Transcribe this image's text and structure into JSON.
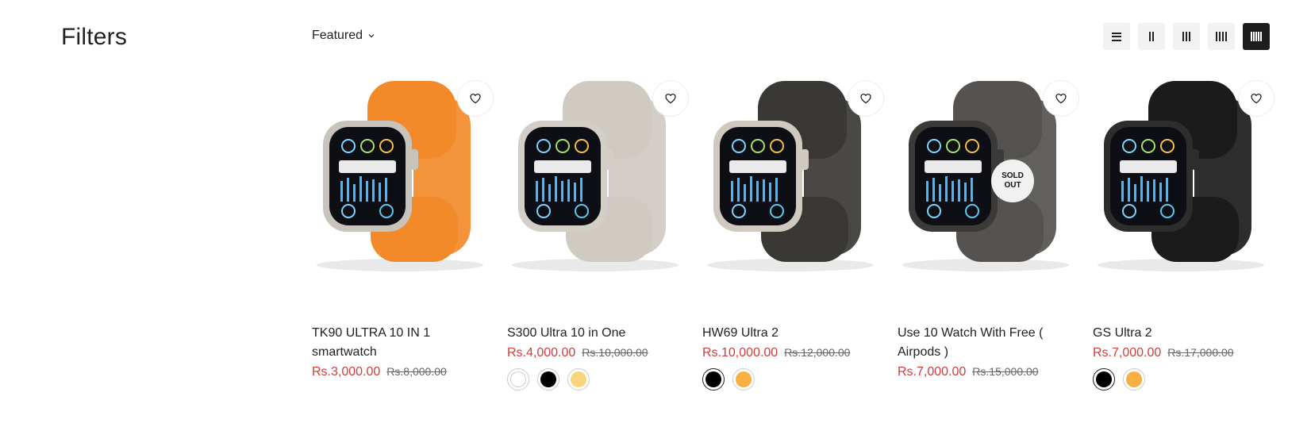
{
  "sidebar": {
    "title": "Filters"
  },
  "toolbar": {
    "sort_label": "Featured"
  },
  "layout_options": [
    "list",
    "2-columns",
    "3-columns",
    "4-columns",
    "5-columns"
  ],
  "active_layout": "5-columns",
  "products": [
    {
      "title": "TK90 ULTRA 10 IN 1 smartwatch",
      "sale_price": "Rs.3,000.00",
      "compare_price": "Rs.8,000.00",
      "band_color": "#f28a2a",
      "case_color": "#c9c4bb",
      "swatches": []
    },
    {
      "title": "S300 Ultra 10 in One",
      "sale_price": "Rs.4,000.00",
      "compare_price": "Rs.10,000.00",
      "band_color": "#cfcac2",
      "case_color": "#d3cec6",
      "swatches": [
        {
          "color": "#ffffff",
          "selected": false
        },
        {
          "color": "#000000",
          "selected": false
        },
        {
          "color": "#f9d57f",
          "selected": false
        }
      ]
    },
    {
      "title": "HW69 Ultra 2",
      "sale_price": "Rs.10,000.00",
      "compare_price": "Rs.12,000.00",
      "band_color": "#3a3835",
      "case_color": "#cfc9bf",
      "swatches": [
        {
          "color": "#000000",
          "selected": true
        },
        {
          "color": "#f7b041",
          "selected": false
        }
      ]
    },
    {
      "title": "Use 10 Watch With Free ( Airpods )",
      "sale_price": "Rs.7,000.00",
      "compare_price": "Rs.15,000.00",
      "band_color": "#55524f",
      "case_color": "#3c3a38",
      "sold_out": "SOLD OUT",
      "swatches": []
    },
    {
      "title": "GS Ultra 2",
      "sale_price": "Rs.7,000.00",
      "compare_price": "Rs.17,000.00",
      "band_color": "#1b1b1b",
      "case_color": "#2d2d2d",
      "swatches": [
        {
          "color": "#000000",
          "selected": true
        },
        {
          "color": "#f7b041",
          "selected": false
        }
      ]
    }
  ]
}
